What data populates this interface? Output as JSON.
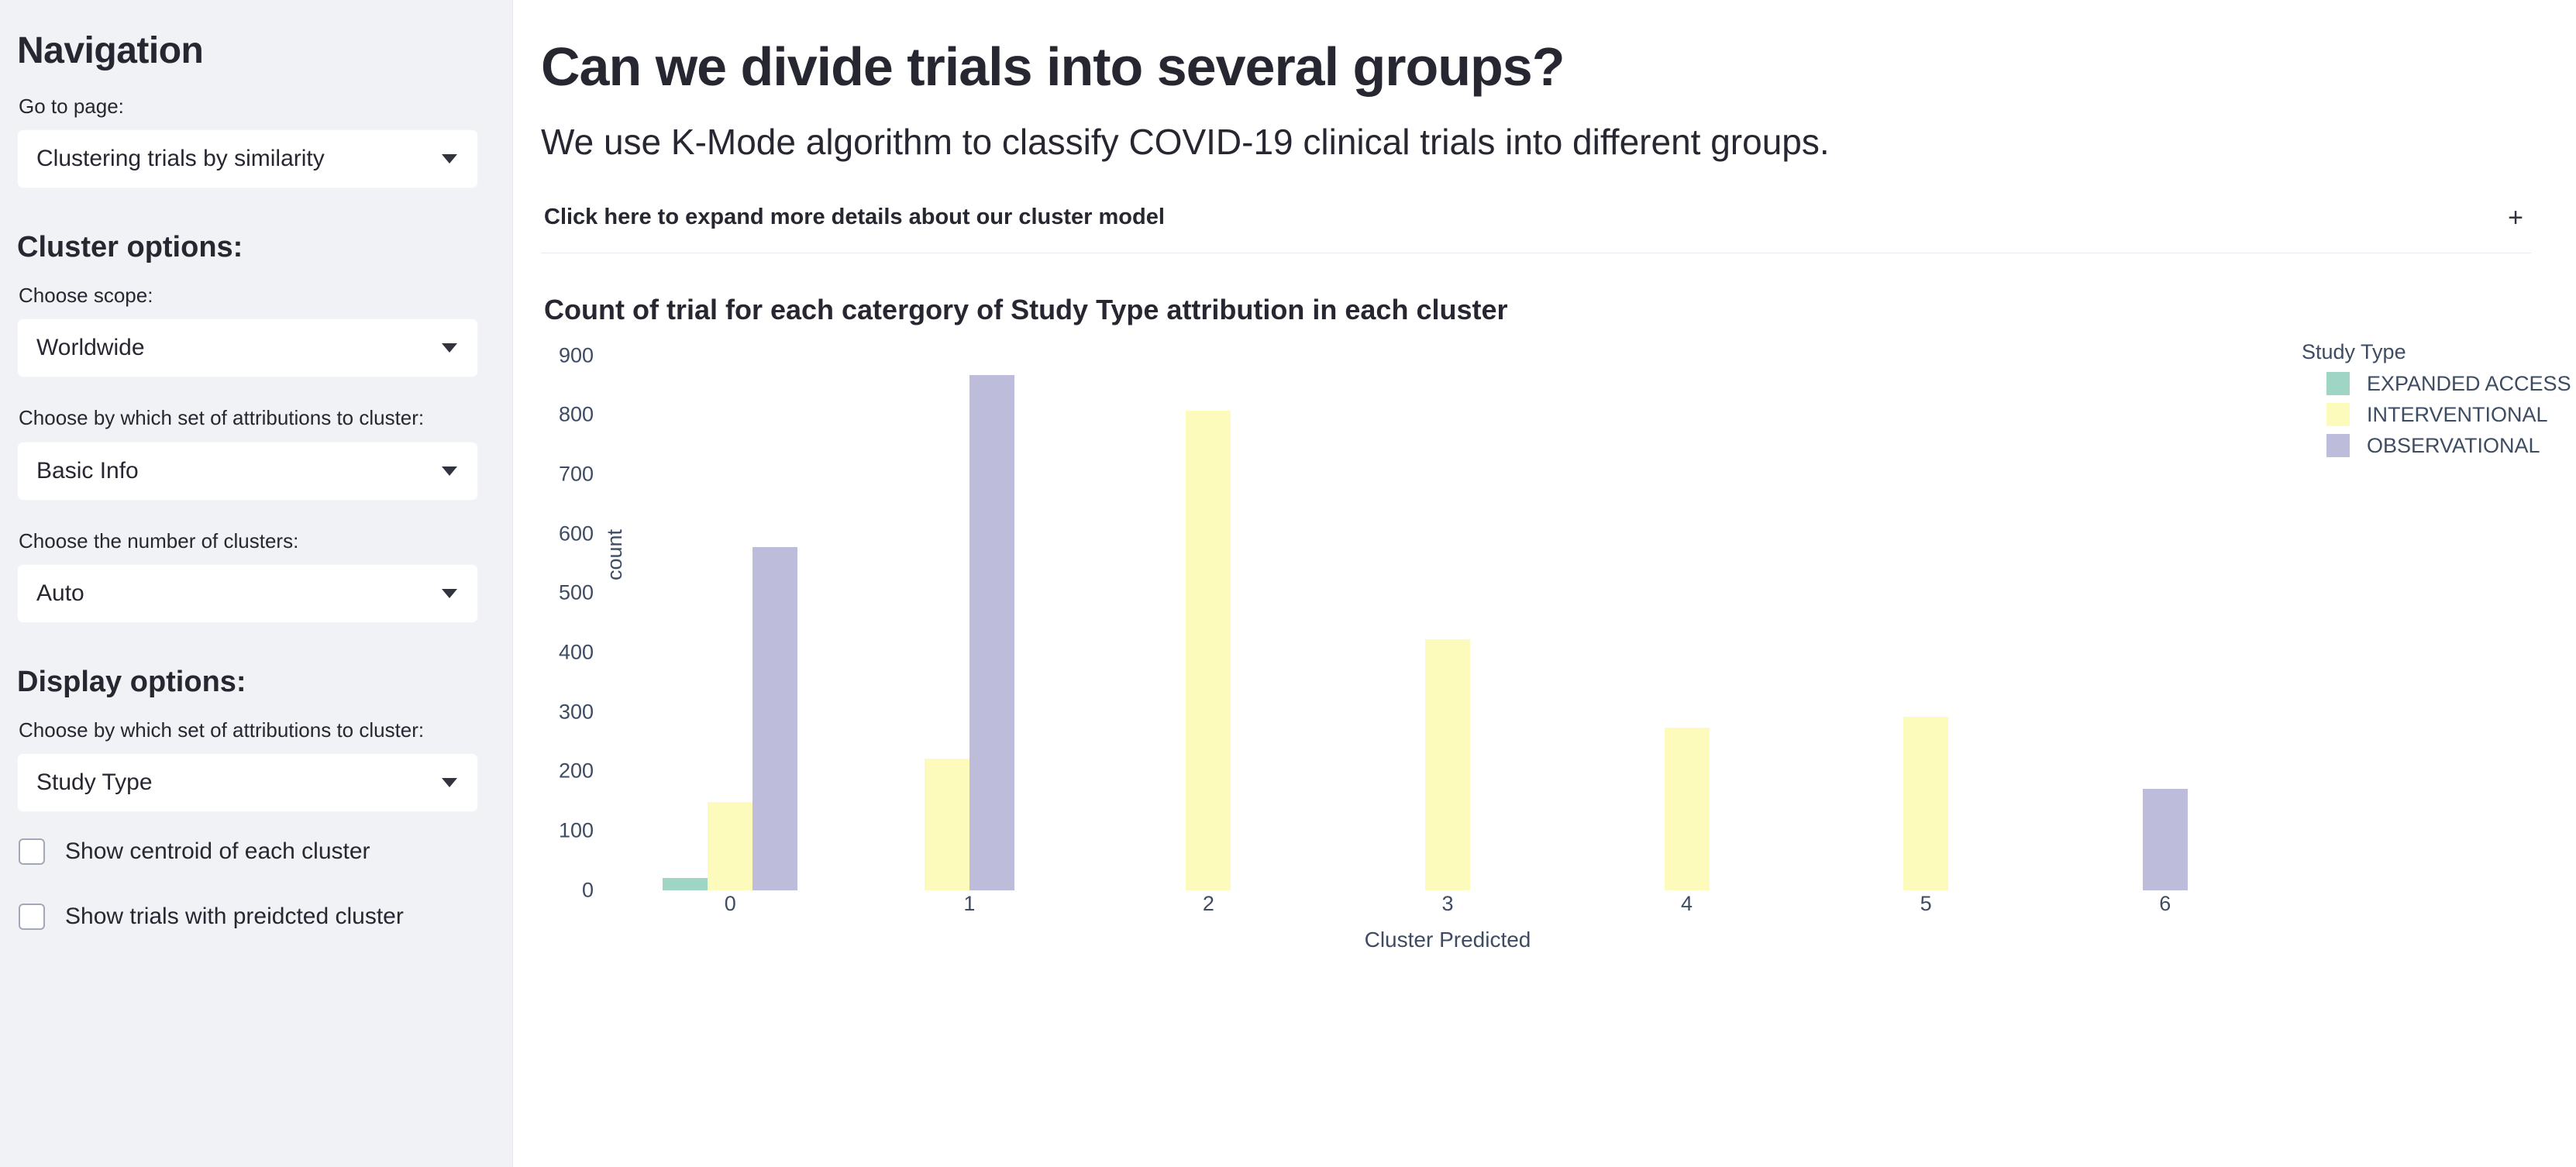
{
  "sidebar": {
    "nav_heading": "Navigation",
    "goto_label": "Go to page:",
    "goto_value": "Clustering trials by similarity",
    "cluster_heading": "Cluster options:",
    "scope_label": "Choose scope:",
    "scope_value": "Worldwide",
    "attrib_label": "Choose by which set of attributions to cluster:",
    "attrib_value": "Basic Info",
    "numclusters_label": "Choose the number of clusters:",
    "numclusters_value": "Auto",
    "display_heading": "Display options:",
    "display_attrib_label": "Choose by which set of attributions to cluster:",
    "display_attrib_value": "Study Type",
    "checkbox_centroid": "Show centroid of each cluster",
    "checkbox_predicted": "Show trials with preidcted cluster"
  },
  "main": {
    "title": "Can we divide trials into several groups?",
    "subtitle": "We use K-Mode algorithm to classify COVID-19 clinical trials into different groups.",
    "expander_label": "Click here to expand more details about our cluster model",
    "expander_icon": "plus-icon"
  },
  "chart_data": {
    "type": "bar",
    "title": "Count of trial for each catergory of Study Type attribution in each cluster",
    "xlabel": "Cluster Predicted",
    "ylabel": "count",
    "categories": [
      "0",
      "1",
      "2",
      "3",
      "4",
      "5",
      "6"
    ],
    "legend_title": "Study Type",
    "legend_position": "right",
    "grid": false,
    "ylim": [
      0,
      900
    ],
    "yticks": [
      900,
      800,
      700,
      600,
      500,
      400,
      300,
      200,
      100,
      0
    ],
    "series": [
      {
        "name": "EXPANDED ACCESS",
        "color": "#9ED5C5",
        "values": [
          20,
          0,
          0,
          0,
          0,
          0,
          0
        ]
      },
      {
        "name": "INTERVENTIONAL",
        "color": "#FCFBBB",
        "values": [
          148,
          222,
          807,
          423,
          274,
          292,
          0
        ]
      },
      {
        "name": "OBSERVATIONAL",
        "color": "#BDBCDB",
        "values": [
          578,
          867,
          0,
          0,
          0,
          0,
          171
        ]
      }
    ]
  }
}
